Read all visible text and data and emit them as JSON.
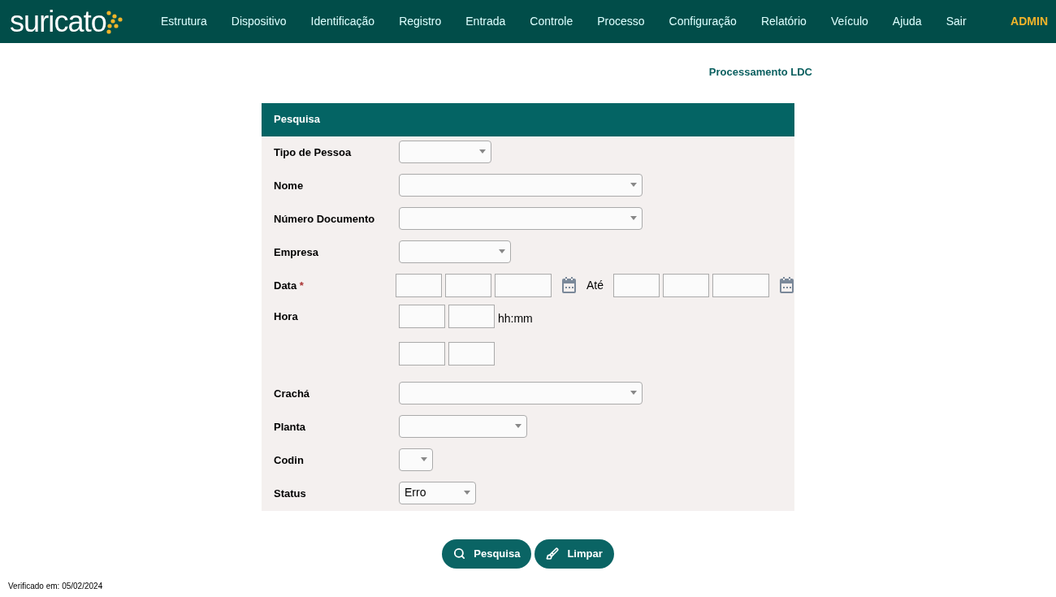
{
  "header": {
    "logo": "suricato",
    "menu": [
      "Estrutura",
      "Dispositivo",
      "Identificação",
      "Registro",
      "Entrada",
      "Controle",
      "Processo",
      "Configuração",
      "Relatório",
      "Veículo",
      "Ajuda",
      "Sair"
    ],
    "user": "ADMIN"
  },
  "page_title": "Processamento LDC",
  "panel": {
    "title": "Pesquisa",
    "rows": [
      {
        "kind": "select",
        "label": "Tipo de Pessoa"
      },
      {
        "kind": "select",
        "label": "Nome"
      },
      {
        "kind": "select",
        "label": "Número Documento"
      },
      {
        "kind": "select",
        "label": "Empresa"
      },
      {
        "kind": "date",
        "label": "Data",
        "required": true,
        "required_mark": "*",
        "separator": "Até"
      },
      {
        "kind": "time",
        "label": "Hora",
        "hint": "hh:mm"
      },
      {
        "kind": "time"
      },
      {
        "kind": "select",
        "label": "Crachá"
      },
      {
        "kind": "select",
        "label": "Planta"
      },
      {
        "kind": "select",
        "label": "Codin"
      },
      {
        "kind": "select",
        "label": "Status",
        "value": "Erro"
      }
    ]
  },
  "buttons": [
    {
      "kind": "search",
      "label": "Pesquisa"
    },
    {
      "kind": "clear",
      "label": "Limpar"
    }
  ],
  "footer": "Verificado em: 05/02/2024"
}
